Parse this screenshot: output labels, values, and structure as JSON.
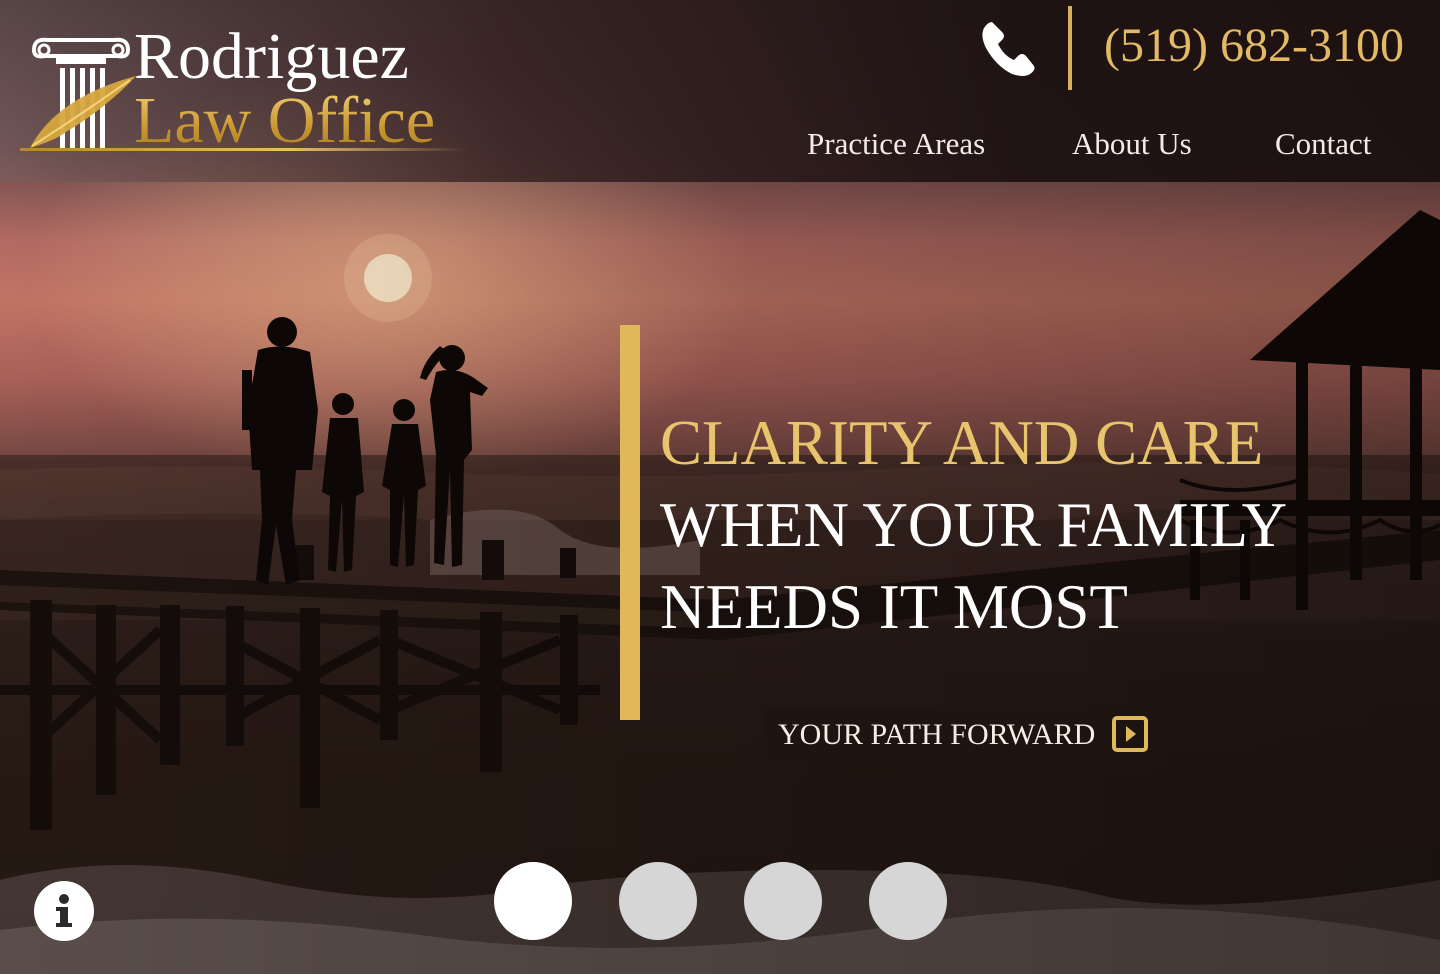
{
  "brand": {
    "name_line1": "Rodriguez",
    "name_line2": "Law Office",
    "logo_icon": "pillar-quill-icon",
    "gold": "#e0b85a"
  },
  "contact": {
    "phone_icon": "phone-icon",
    "phone_number": "(519) 682-3100"
  },
  "nav": {
    "items": [
      {
        "label": "Practice Areas"
      },
      {
        "label": "About Us"
      },
      {
        "label": "Contact"
      }
    ]
  },
  "hero": {
    "headline": {
      "line1": "Clarity and Care",
      "line2": "When Your Family",
      "line3": "Needs It Most"
    },
    "cta": {
      "label": "Your Path Forward",
      "icon": "play-square-icon"
    },
    "slider": {
      "slide_count": 4,
      "active_slide": 1
    },
    "info_icon": "info-icon"
  }
}
